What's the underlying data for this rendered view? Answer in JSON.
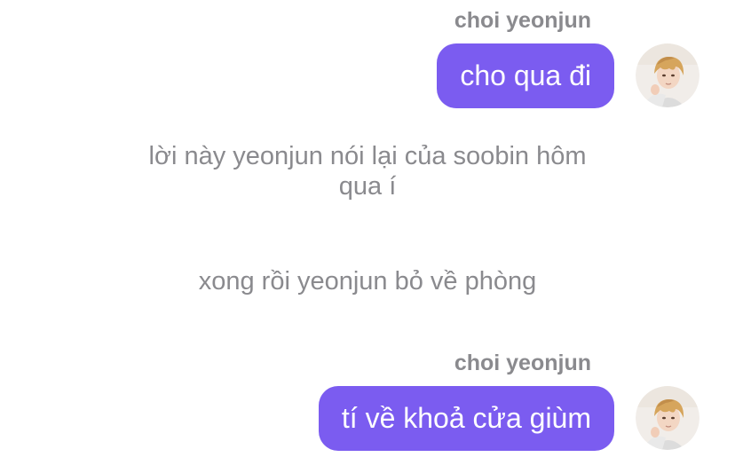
{
  "messages": [
    {
      "sender": "choi yeonjun",
      "text": "cho qua đi"
    },
    {
      "sender": "choi yeonjun",
      "text": "tí về khoả cửa giùm"
    }
  ],
  "narration": [
    {
      "lines": [
        "lời này yeonjun nói lại của soobin hôm",
        "qua í"
      ]
    },
    {
      "lines": [
        "xong rồi yeonjun bỏ về phòng"
      ]
    }
  ],
  "colors": {
    "bubble": "#7b5cf0",
    "bubble_text": "#ffffff",
    "muted_text": "#8a8a8e",
    "background": "#ffffff"
  },
  "icons": {
    "avatar": "user-avatar-photo"
  }
}
